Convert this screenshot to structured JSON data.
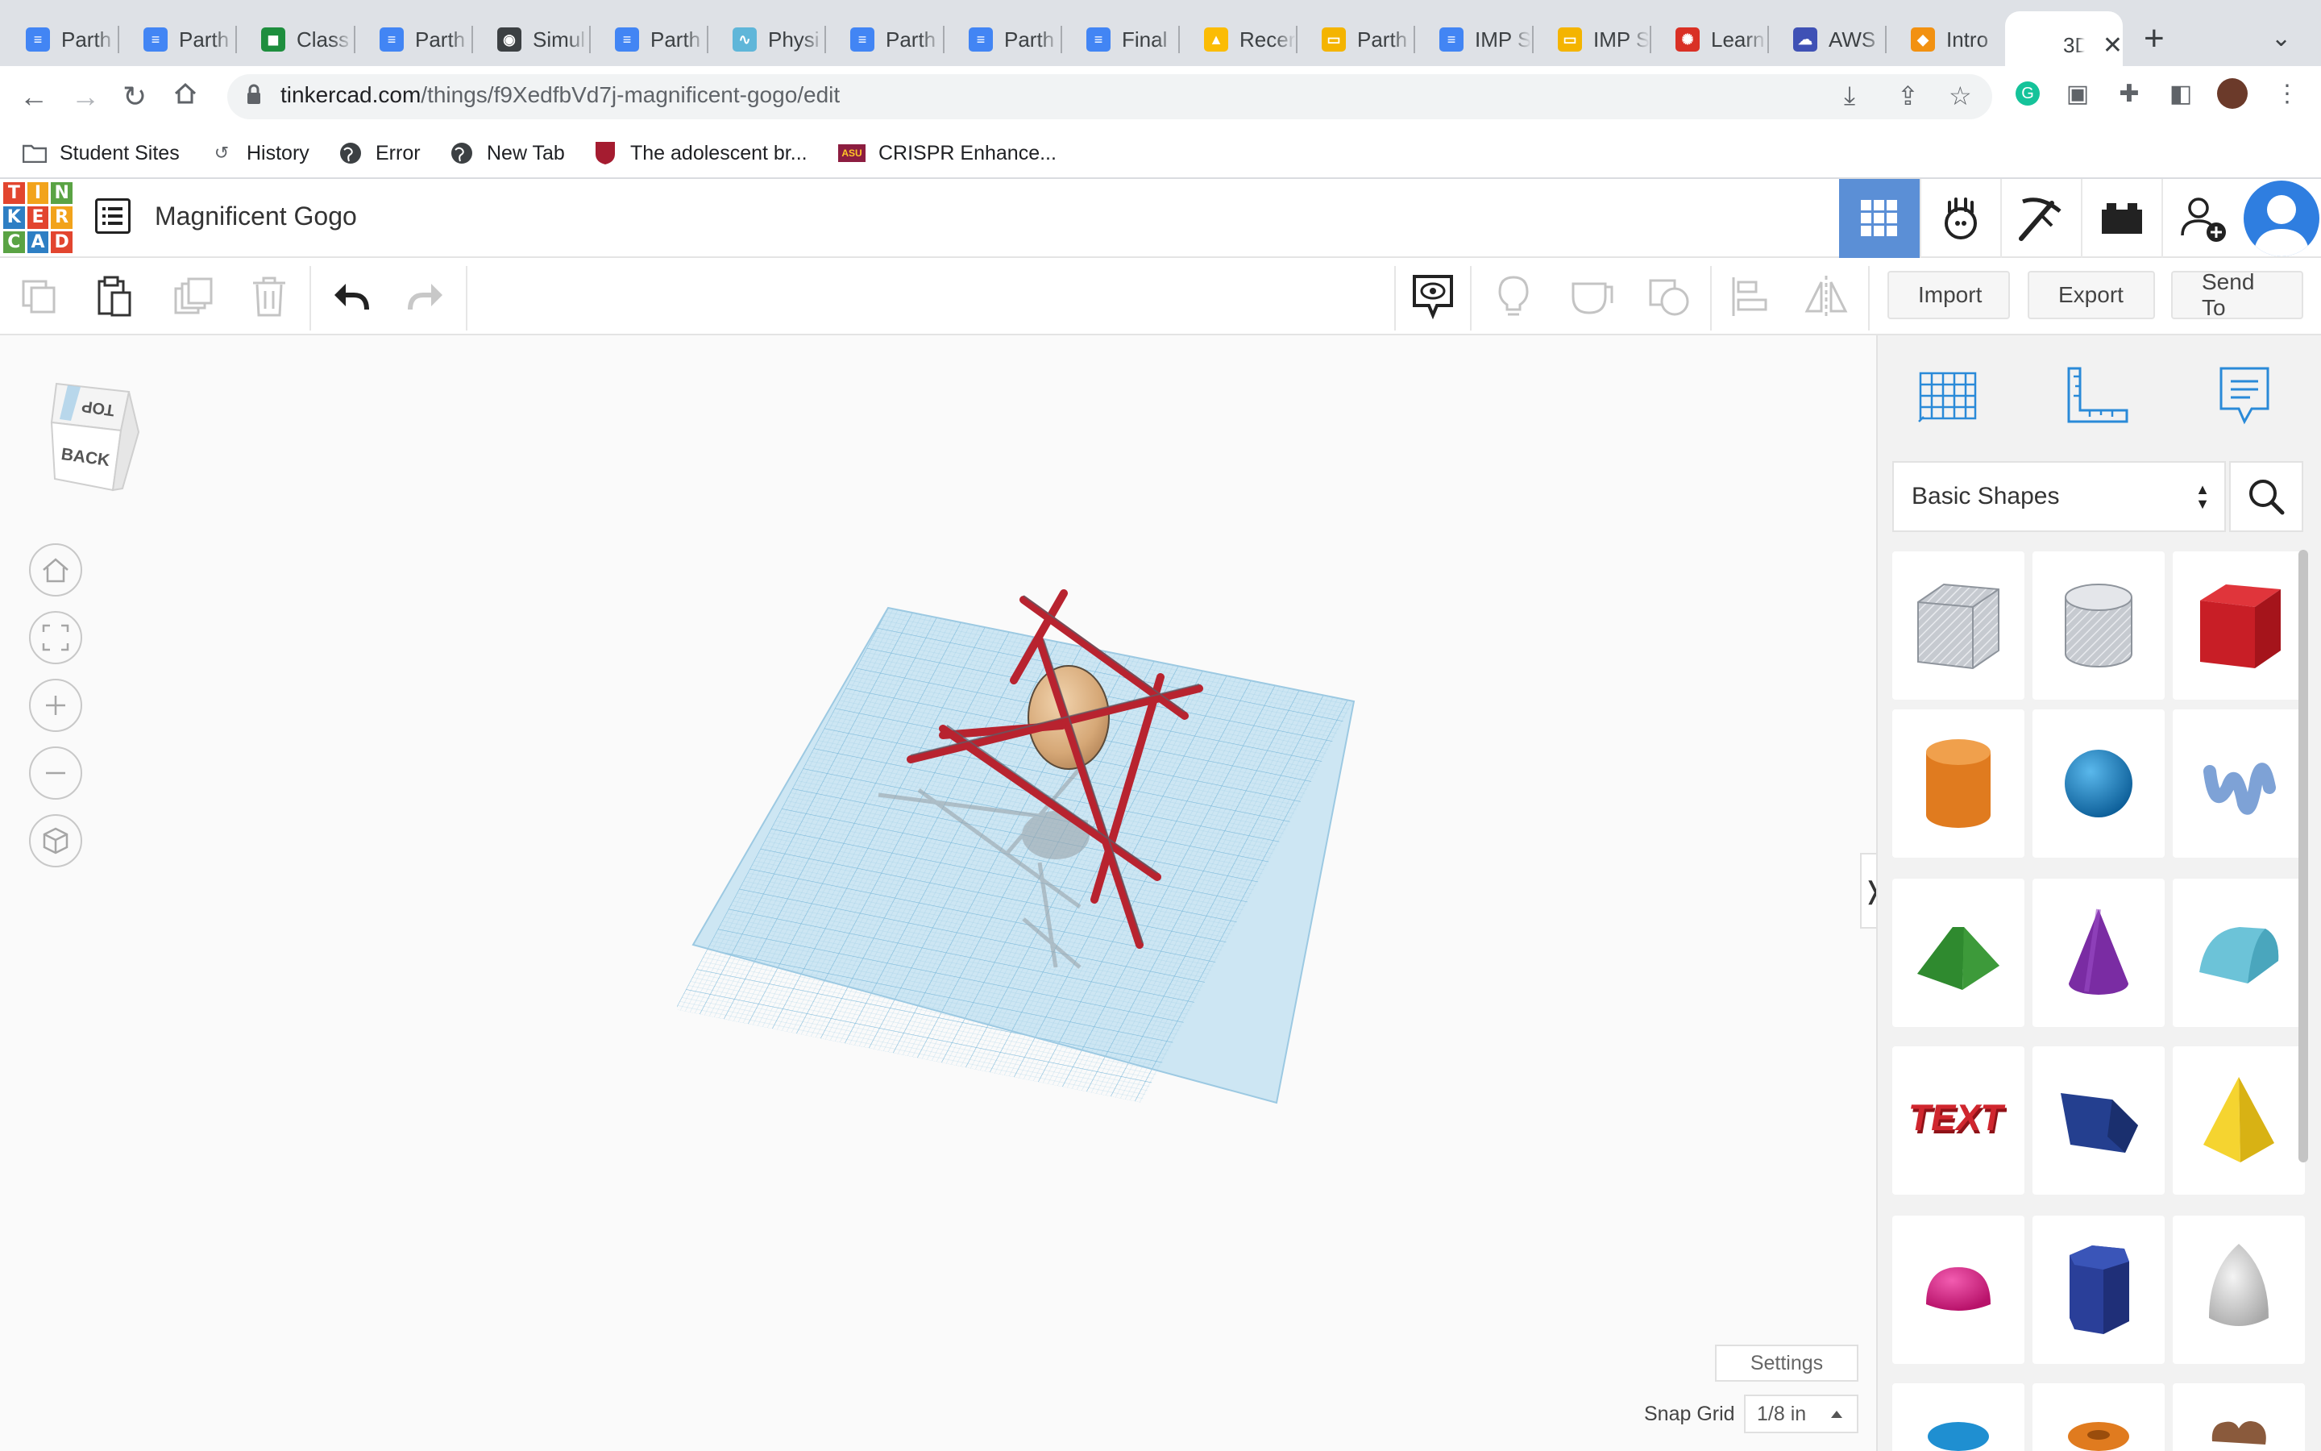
{
  "browser": {
    "tabs": [
      {
        "label": "Parth",
        "icon": "google-docs-icon",
        "color": "#4285f4"
      },
      {
        "label": "Parth",
        "icon": "google-docs-icon",
        "color": "#4285f4"
      },
      {
        "label": "Class",
        "icon": "google-classroom-icon",
        "color": "#1e8e3e"
      },
      {
        "label": "Parth",
        "icon": "google-docs-icon",
        "color": "#4285f4"
      },
      {
        "label": "Simul",
        "icon": "globe-icon",
        "color": "#3c4043"
      },
      {
        "label": "Parth",
        "icon": "google-docs-icon",
        "color": "#4285f4"
      },
      {
        "label": "Physi",
        "icon": "physics-sim-icon",
        "color": "#5fb6d9"
      },
      {
        "label": "Parth",
        "icon": "google-docs-icon",
        "color": "#4285f4"
      },
      {
        "label": "Parth",
        "icon": "google-docs-icon",
        "color": "#4285f4"
      },
      {
        "label": "Final",
        "icon": "google-docs-icon",
        "color": "#4285f4"
      },
      {
        "label": "Recer",
        "icon": "google-drive-icon",
        "color": "#fbbc04"
      },
      {
        "label": "Parth",
        "icon": "google-slides-icon",
        "color": "#f4b400"
      },
      {
        "label": "IMP S",
        "icon": "google-docs-icon",
        "color": "#4285f4"
      },
      {
        "label": "IMP S",
        "icon": "google-slides-icon",
        "color": "#f4b400"
      },
      {
        "label": "Learn",
        "icon": "learn-icon",
        "color": "#d93025"
      },
      {
        "label": "AWS",
        "icon": "aws-icon",
        "color": "#3f51b5"
      },
      {
        "label": "Intro",
        "icon": "box-icon",
        "color": "#f29111"
      }
    ],
    "active_tab": {
      "label": "3D",
      "icon": "tinkercad-icon"
    },
    "url_host": "tinkercad.com",
    "url_path": "/things/f9XedfbVd7j-magnificent-gogo/edit",
    "bookmarks": [
      {
        "label": "Student Sites",
        "icon": "folder-icon"
      },
      {
        "label": "History",
        "icon": "history-icon"
      },
      {
        "label": "Error",
        "icon": "globe-icon"
      },
      {
        "label": "New Tab",
        "icon": "globe-icon"
      },
      {
        "label": "The adolescent br...",
        "icon": "harvard-icon"
      },
      {
        "label": "CRISPR Enhance...",
        "icon": "asu-icon"
      }
    ]
  },
  "app": {
    "logo_letters": [
      "T",
      "I",
      "N",
      "K",
      "E",
      "R",
      "C",
      "A",
      "D"
    ],
    "logo_colors": [
      "#e2452f",
      "#f2a31b",
      "#5aa344",
      "#2e7fc4",
      "#e2452f",
      "#f2a31b",
      "#5aa344",
      "#2e7fc4",
      "#e2452f"
    ],
    "design_name": "Magnificent Gogo",
    "toolbar": {
      "import_label": "Import",
      "export_label": "Export",
      "send_to_label": "Send To"
    },
    "viewcube": {
      "top_label": "TOP",
      "back_label": "BACK"
    },
    "workplane": {
      "settings_label": "Settings",
      "snap_grid_label": "Snap Grid",
      "snap_grid_value": "1/8 in"
    },
    "panel": {
      "shape_category": "Basic Shapes",
      "shapes": [
        {
          "name": "box-hole",
          "color": "#b8bcc2"
        },
        {
          "name": "cylinder-hole",
          "color": "#c2c6cc"
        },
        {
          "name": "box",
          "color": "#d11f26"
        },
        {
          "name": "cylinder",
          "color": "#e07b1f"
        },
        {
          "name": "sphere",
          "color": "#1f8fd1"
        },
        {
          "name": "scribble",
          "color": "#7ea2d6"
        },
        {
          "name": "roof",
          "color": "#3d9a3a"
        },
        {
          "name": "cone",
          "color": "#7a2ca3"
        },
        {
          "name": "round-roof",
          "color": "#6cc3d8"
        },
        {
          "name": "text",
          "color": "#c9202a"
        },
        {
          "name": "polygon",
          "color": "#243f8f"
        },
        {
          "name": "pyramid",
          "color": "#f0cc2a"
        },
        {
          "name": "half-sphere",
          "color": "#e61f8c"
        },
        {
          "name": "hexagonal-prism",
          "color": "#2a3f99"
        },
        {
          "name": "paraboloid",
          "color": "#d8d8d8"
        }
      ]
    }
  }
}
